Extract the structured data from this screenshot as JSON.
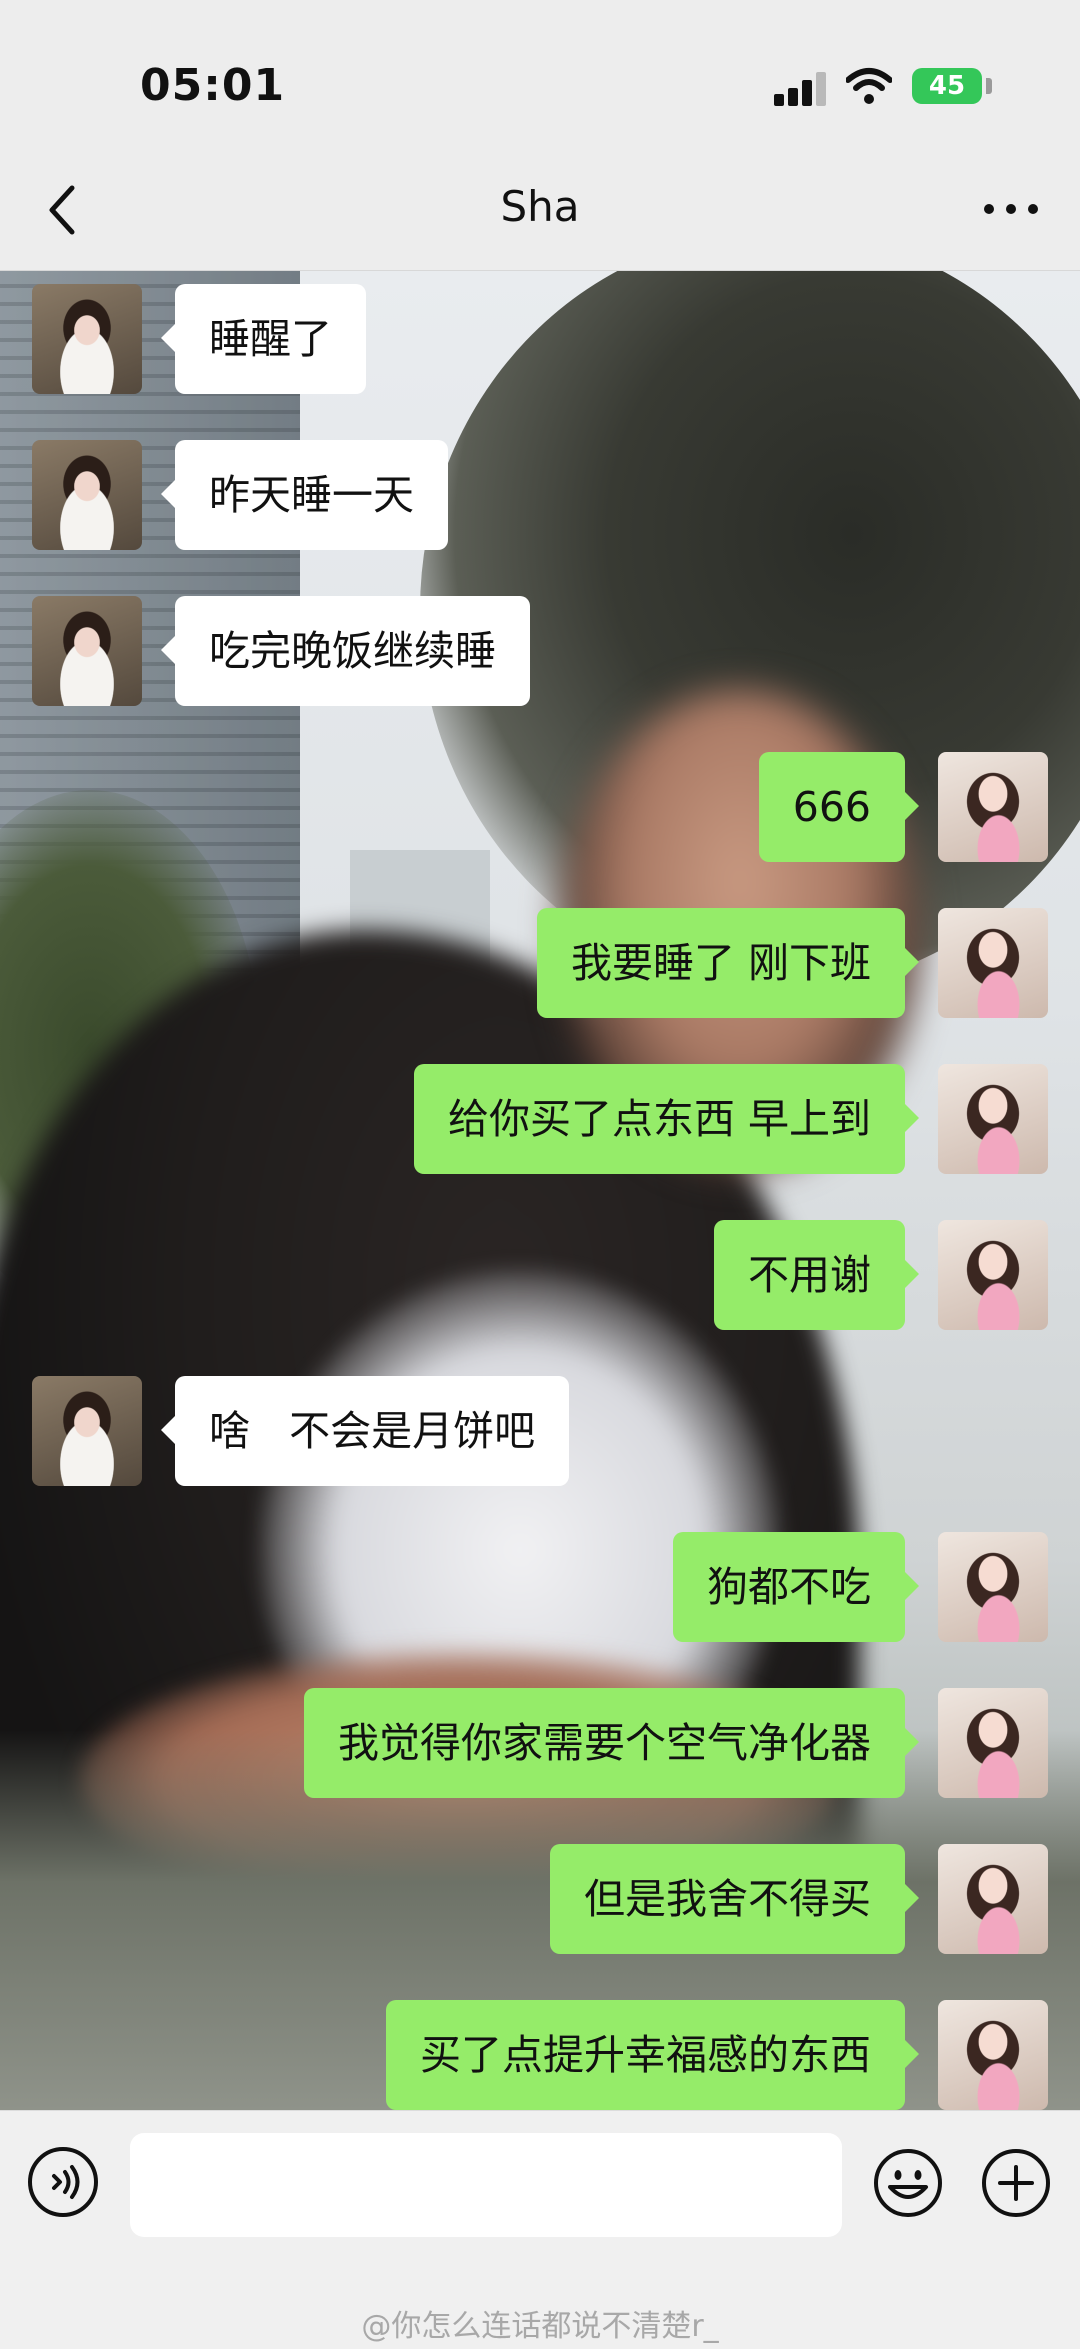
{
  "status_bar": {
    "time": "05:01",
    "battery": "45"
  },
  "header": {
    "title": "Sha"
  },
  "messages": [
    {
      "side": "in",
      "text": "睡醒了"
    },
    {
      "side": "in",
      "text": "昨天睡一天"
    },
    {
      "side": "in",
      "text": "吃完晚饭继续睡"
    },
    {
      "side": "out",
      "text": "666"
    },
    {
      "side": "out",
      "text": "我要睡了 刚下班"
    },
    {
      "side": "out",
      "text": "给你买了点东西 早上到"
    },
    {
      "side": "out",
      "text": "不用谢"
    },
    {
      "side": "in",
      "text": "啥   不会是月饼吧"
    },
    {
      "side": "out",
      "text": "狗都不吃"
    },
    {
      "side": "out",
      "text": "我觉得你家需要个空气净化器"
    },
    {
      "side": "out",
      "text": "但是我舍不得买"
    },
    {
      "side": "out",
      "text": "买了点提升幸福感的东西"
    }
  ],
  "input": {
    "value": ""
  },
  "watermark": "@你怎么连话都说不清楚r_",
  "colors": {
    "outgoing_bubble": "#95ec69",
    "incoming_bubble": "#ffffff",
    "battery": "#34c759"
  }
}
